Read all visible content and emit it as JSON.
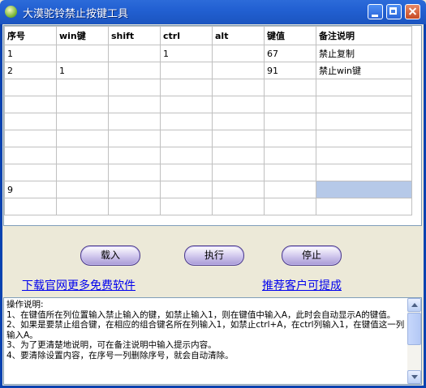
{
  "window": {
    "title": "大漠驼铃禁止按键工具"
  },
  "grid": {
    "columns": [
      "序号",
      "win键",
      "shift",
      "ctrl",
      "alt",
      "键值",
      "备注说明"
    ],
    "rows": [
      [
        "1",
        "",
        "",
        "1",
        "",
        "67",
        "禁止复制"
      ],
      [
        "2",
        "1",
        "",
        "",
        "",
        "91",
        "禁止win键"
      ],
      [
        "",
        "",
        "",
        "",
        "",
        "",
        ""
      ],
      [
        "",
        "",
        "",
        "",
        "",
        "",
        ""
      ],
      [
        "",
        "",
        "",
        "",
        "",
        "",
        ""
      ],
      [
        "",
        "",
        "",
        "",
        "",
        "",
        ""
      ],
      [
        "",
        "",
        "",
        "",
        "",
        "",
        ""
      ],
      [
        "",
        "",
        "",
        "",
        "",
        "",
        ""
      ],
      [
        "9",
        "",
        "",
        "",
        "",
        "",
        ""
      ],
      [
        "",
        "",
        "",
        "",
        "",
        "",
        ""
      ]
    ]
  },
  "buttons": {
    "load": "载入",
    "execute": "执行",
    "stop": "停止"
  },
  "links": {
    "download": "下载官网更多免费软件",
    "recommend": "推荐客户可提成"
  },
  "help": {
    "text": "操作说明:\n1、在键值所在列位置输入禁止输入的键，如禁止输入1，则在键值中输入A，此时会自动显示A的键值。\n2、如果是要禁止组合键，在相应的组合键名所在列输入1，如禁止ctrl+A，在ctrl列输入1，在键值这一列输入A。\n3、为了更清楚地说明，可在备注说明中输入提示内容。\n4、要清除设置内容，在序号一列删除序号，就会自动清除。"
  },
  "colors": {
    "titlebar": "#2260D2",
    "selected_cell": "#B6C9E8",
    "link": "#0000EE"
  }
}
